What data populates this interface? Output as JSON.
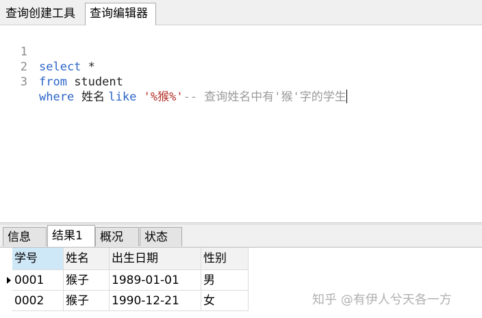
{
  "top_tabs": [
    "查询创建工具",
    "查询编辑器"
  ],
  "editor": {
    "line_numbers": [
      "1",
      "2",
      "3"
    ],
    "line1": {
      "kw": "select",
      "rest": " *"
    },
    "line2": {
      "kw": "from",
      "rest": " student"
    },
    "line3": {
      "kw": "where",
      "col": "  姓名 ",
      "kw2": "like",
      "sp": " ",
      "str": "'%猴%'",
      "cmt": "-- 查询姓名中有'猴'字的学生"
    }
  },
  "result_tabs": [
    "信息",
    "结果1",
    "概况",
    "状态"
  ],
  "grid": {
    "columns": [
      "学号",
      "姓名",
      "出生日期",
      "性别"
    ],
    "rows": [
      [
        "0001",
        "猴子",
        "1989-01-01",
        "男"
      ],
      [
        "0002",
        "猴子",
        "1990-12-21",
        "女"
      ]
    ]
  },
  "watermark": "知乎 @有伊人兮天各一方",
  "colors": {
    "keyword": "#2a64c8",
    "string": "#b3322a",
    "comment": "#9a9a9a",
    "header_selected": "#cfe8f8"
  }
}
